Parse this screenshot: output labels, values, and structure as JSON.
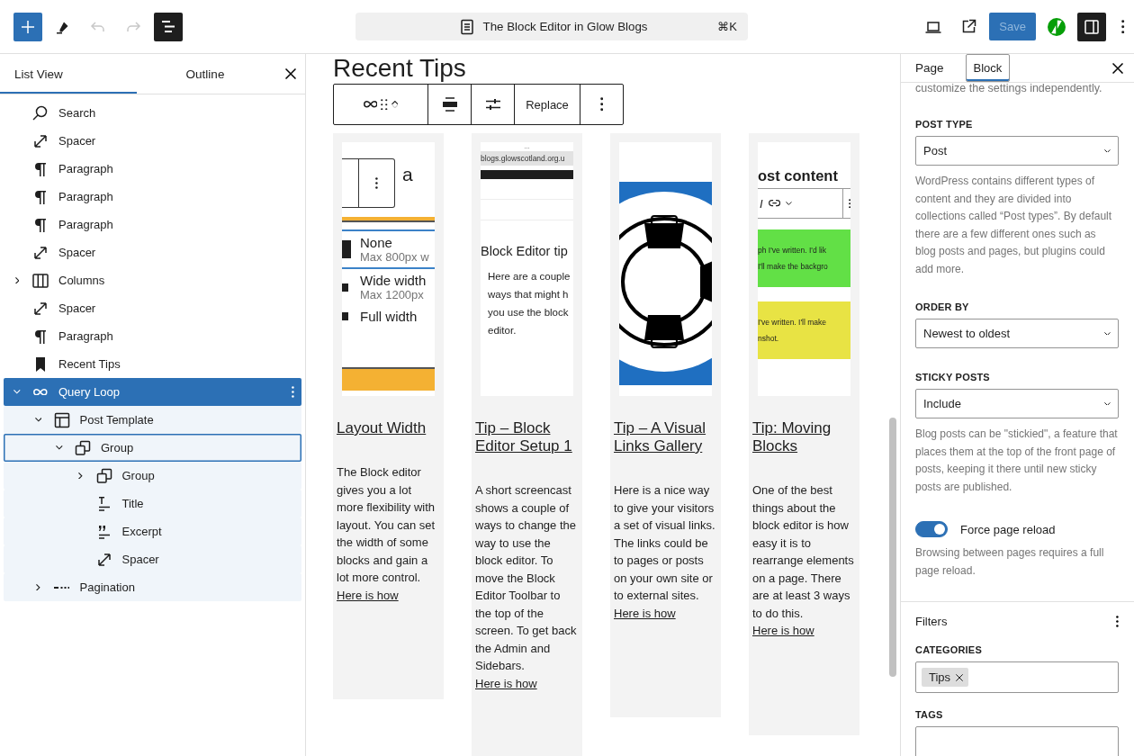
{
  "toolbar": {
    "document_title": "The Block Editor in Glow Blogs",
    "shortcut": "⌘K",
    "save_label": "Save",
    "save_disabled": true,
    "undo_disabled": true,
    "redo_disabled": true,
    "list_view_on": true,
    "settings_on": true
  },
  "list_panel": {
    "tabs": [
      {
        "label": "List View",
        "selected": true
      },
      {
        "label": "Outline",
        "selected": false
      }
    ],
    "tree": [
      {
        "label": "Search",
        "kind": "search",
        "selected": false,
        "focused": false
      },
      {
        "label": "Spacer",
        "kind": "spacer",
        "selected": false,
        "focused": false
      },
      {
        "label": "Paragraph",
        "kind": "paragraph",
        "selected": false,
        "focused": false
      },
      {
        "label": "Paragraph",
        "kind": "paragraph",
        "selected": false,
        "focused": false
      },
      {
        "label": "Paragraph",
        "kind": "paragraph",
        "selected": false,
        "focused": false
      },
      {
        "label": "Spacer",
        "kind": "spacer",
        "selected": false,
        "focused": false
      },
      {
        "label": "Columns",
        "kind": "columns",
        "selected": false,
        "focused": false,
        "expanded": false
      },
      {
        "label": "Spacer",
        "kind": "spacer",
        "selected": false,
        "focused": false
      },
      {
        "label": "Paragraph",
        "kind": "paragraph",
        "selected": false,
        "focused": false
      },
      {
        "label": "Recent Tips",
        "kind": "bookmark",
        "selected": false,
        "focused": false
      },
      {
        "label": "Query Loop",
        "kind": "loop",
        "selected": true,
        "focused": false,
        "expanded": true,
        "children": [
          {
            "label": "Post Template",
            "kind": "template",
            "selected": false,
            "focused": false,
            "expanded": true,
            "children": [
              {
                "label": "Group",
                "kind": "group",
                "selected": false,
                "focused": true,
                "expanded": true,
                "children": [
                  {
                    "label": "Group",
                    "kind": "group",
                    "selected": false,
                    "focused": false,
                    "expanded": false
                  },
                  {
                    "label": "Title",
                    "kind": "title",
                    "selected": false,
                    "focused": false
                  },
                  {
                    "label": "Excerpt",
                    "kind": "excerpt",
                    "selected": false,
                    "focused": false
                  },
                  {
                    "label": "Spacer",
                    "kind": "spacer",
                    "selected": false,
                    "focused": false
                  }
                ]
              }
            ]
          },
          {
            "label": "Pagination",
            "kind": "pagination",
            "selected": false,
            "focused": false,
            "expanded": false
          }
        ]
      }
    ]
  },
  "canvas": {
    "heading": "Recent Tips",
    "block_toolbar": {
      "replace_label": "Replace"
    },
    "posts": [
      {
        "title": "Layout Width",
        "excerpt": "The Block editor gives you a lot more flexibility with layout. You can set the width of some blocks and gain a lot more control.",
        "link": "Here is how",
        "thumbnail": {
          "kind": "layout-menu",
          "fragment": "a",
          "options": [
            {
              "label": "None",
              "detail": "Max 800px w",
              "selected": true
            },
            {
              "label": "Wide width",
              "detail": "Max 1200px",
              "selected": false
            },
            {
              "label": "Full width",
              "selected": false
            }
          ]
        }
      },
      {
        "title": "Tip – Block Editor Setup 1",
        "excerpt": "A short screencast shows a couple of ways to change the way to use the block editor. To move the Block Editor Toolbar to the top of the screen. To get back the Admin and Sidebars.",
        "link": "Here is how",
        "thumbnail": {
          "kind": "browser",
          "dots": "...",
          "url": "blogs.glowscotland.org.u",
          "heading": "Block Editor tip",
          "body_lines": [
            "Here are a couple",
            "ways that might h",
            "you use the block",
            "editor."
          ]
        }
      },
      {
        "title": "Tip – A Visual Links Gallery",
        "excerpt": "Here is a nice way to give your visitors a set of visual links. The links could be to pages or posts on your own site or to external sites.",
        "link": "Here is how",
        "thumbnail": {
          "kind": "lifebuoy"
        }
      },
      {
        "title": "Tip: Moving Blocks",
        "excerpt": "One of the best things about the block editor is how easy it is to rearrange elements on a page. There are at least 3 ways to do this.",
        "link": "Here is how",
        "thumbnail": {
          "kind": "editor",
          "heading": "ost content",
          "format_label": "I",
          "blocks": [
            {
              "color": "#62e046",
              "lines": [
                "ph I've written. I'd lik",
                "I'll make the backgro"
              ]
            },
            {
              "color": "#e8e344",
              "lines": [
                "I've written. I'll make",
                "nshot."
              ]
            }
          ]
        }
      }
    ]
  },
  "inspector": {
    "tabs": [
      {
        "label": "Page",
        "selected": false
      },
      {
        "label": "Block",
        "selected": true
      }
    ],
    "intro": "customize the settings independently.",
    "settings": [
      {
        "kind": "select",
        "label": "POST TYPE",
        "value": "Post",
        "help": "WordPress contains different types of content and they are divided into collections called “Post types”. By default there are a few different ones such as blog posts and pages, but plugins could add more."
      },
      {
        "kind": "select",
        "label": "ORDER BY",
        "value": "Newest to oldest"
      },
      {
        "kind": "select",
        "label": "STICKY POSTS",
        "value": "Include",
        "help": "Blog posts can be \"stickied\", a feature that places them at the top of the front page of posts, keeping it there until new sticky posts are published."
      },
      {
        "kind": "toggle",
        "label": "Force page reload",
        "on": true,
        "help": "Browsing between pages requires a full page reload."
      }
    ],
    "filters": {
      "title": "Filters",
      "fields": [
        {
          "label": "CATEGORIES",
          "tokens": [
            "Tips"
          ]
        },
        {
          "label": "TAGS"
        }
      ]
    }
  }
}
